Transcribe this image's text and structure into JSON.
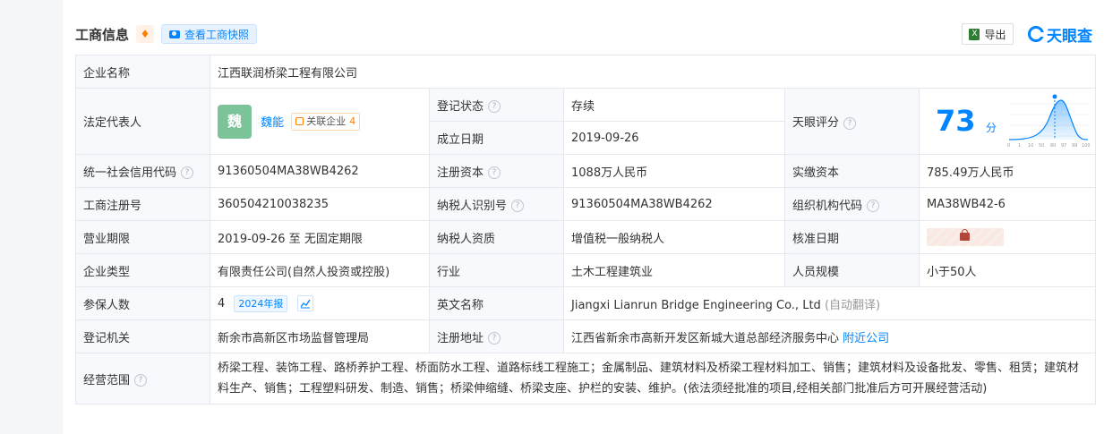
{
  "header": {
    "title": "工商信息",
    "snapshot_button": "查看工商快照",
    "export_button": "导出",
    "brand": "天眼查"
  },
  "rows": {
    "company_name": {
      "label": "企业名称",
      "value": "江西联润桥梁工程有限公司"
    },
    "legal_rep": {
      "label": "法定代表人",
      "avatar": "魏",
      "name": "魏能",
      "related_label": "关联企业",
      "related_count": "4"
    },
    "reg_status": {
      "label": "登记状态",
      "value": "存续"
    },
    "found_date": {
      "label": "成立日期",
      "value": "2019-09-26"
    },
    "tianyan_score": {
      "label": "天眼评分",
      "value": "73",
      "unit": "分",
      "axis": [
        "0",
        "1",
        "10",
        "50",
        "80",
        "97",
        "99",
        "100"
      ]
    },
    "credit_code": {
      "label": "统一社会信用代码",
      "value": "91360504MA38WB4262"
    },
    "reg_capital": {
      "label": "注册资本",
      "value": "1088万人民币"
    },
    "paid_capital": {
      "label": "实缴资本",
      "value": "785.49万人民币"
    },
    "reg_number": {
      "label": "工商注册号",
      "value": "360504210038235"
    },
    "taxpayer_id": {
      "label": "纳税人识别号",
      "value": "91360504MA38WB4262"
    },
    "org_code": {
      "label": "组织机构代码",
      "value": "MA38WB42-6"
    },
    "business_term": {
      "label": "营业期限",
      "value": "2019-09-26 至 无固定期限"
    },
    "taxpayer_qual": {
      "label": "纳税人资质",
      "value": "增值税一般纳税人"
    },
    "approval_date": {
      "label": "核准日期"
    },
    "company_type": {
      "label": "企业类型",
      "value": "有限责任公司(自然人投资或控股)"
    },
    "industry": {
      "label": "行业",
      "value": "土木工程建筑业"
    },
    "staff_size": {
      "label": "人员规模",
      "value": "小于50人"
    },
    "insured": {
      "label": "参保人数",
      "value": "4",
      "report": "2024年报"
    },
    "english_name": {
      "label": "英文名称",
      "value": "Jiangxi Lianrun Bridge Engineering Co., Ltd",
      "note": "(自动翻译)"
    },
    "reg_authority": {
      "label": "登记机关",
      "value": "新余市高新区市场监督管理局"
    },
    "reg_address": {
      "label": "注册地址",
      "value": "江西省新余市高新开发区新城大道总部经济服务中心",
      "link": "附近公司"
    },
    "scope": {
      "label": "经营范围",
      "value": "桥梁工程、装饰工程、路桥养护工程、桥面防水工程、道路标线工程施工；金属制品、建筑材料及桥梁工程材料加工、销售；建筑材料及设备批发、零售、租赁；建筑材料生产、销售；工程塑料研发、制造、销售；桥梁伸缩缝、桥梁支座、护栏的安装、维护。(依法须经批准的项目,经相关部门批准后方可开展经营活动)"
    }
  },
  "colors": {
    "accent": "#0084ff",
    "status_green": "#00a36c",
    "label_bg": "#f7f9fc",
    "border": "#e5e8ed"
  }
}
